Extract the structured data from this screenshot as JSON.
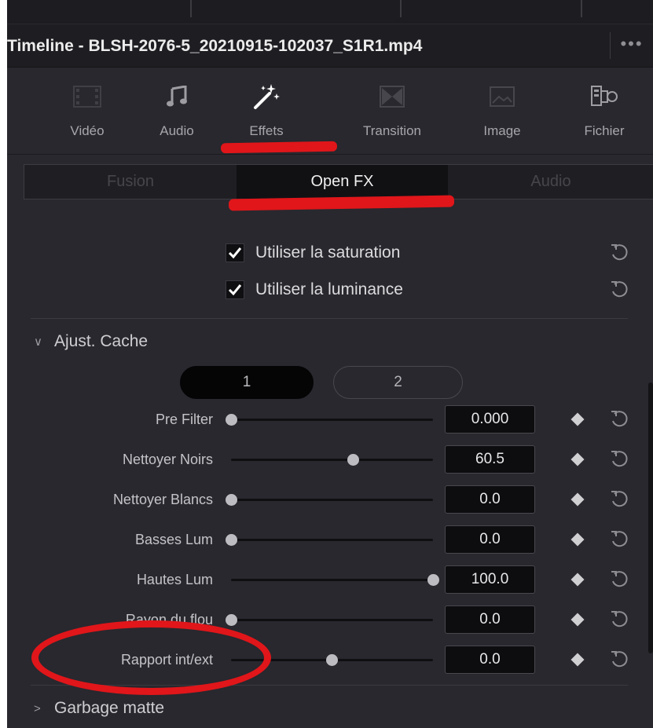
{
  "window": {
    "title": "Timeline - BLSH-2076-5_20210915-102037_S1R1.mp4",
    "more_label": "•••"
  },
  "inspector_tabs": [
    {
      "label": "Vidéo",
      "icon": "film-icon",
      "state": "normal"
    },
    {
      "label": "Audio",
      "icon": "music-note-icon",
      "state": "normal"
    },
    {
      "label": "Effets",
      "icon": "magic-wand-icon",
      "state": "active"
    },
    {
      "label": "Transition",
      "icon": "transition-icon",
      "state": "disabled"
    },
    {
      "label": "Image",
      "icon": "image-icon",
      "state": "disabled"
    },
    {
      "label": "Fichier",
      "icon": "camera-file-icon",
      "state": "normal"
    }
  ],
  "sub_tabs": [
    {
      "label": "Fusion",
      "active": false
    },
    {
      "label": "Open FX",
      "active": true
    },
    {
      "label": "Audio",
      "active": false
    }
  ],
  "checkboxes": [
    {
      "label": "Utiliser la saturation",
      "checked": true
    },
    {
      "label": "Utiliser la luminance",
      "checked": true
    }
  ],
  "section": {
    "label": "Ajust. Cache",
    "expanded": true,
    "segments": [
      "1",
      "2"
    ],
    "selected_segment": "1"
  },
  "params": [
    {
      "label": "Pre Filter",
      "value": "0.000",
      "slider_fraction": 0.0
    },
    {
      "label": "Nettoyer Noirs",
      "value": "60.5",
      "slider_fraction": 0.605
    },
    {
      "label": "Nettoyer Blancs",
      "value": "0.0",
      "slider_fraction": 0.0
    },
    {
      "label": "Basses Lum",
      "value": "0.0",
      "slider_fraction": 0.0
    },
    {
      "label": "Hautes Lum",
      "value": "100.0",
      "slider_fraction": 1.0
    },
    {
      "label": "Rayon du flou",
      "value": "0.0",
      "slider_fraction": 0.0
    },
    {
      "label": "Rapport int/ext",
      "value": "0.0",
      "slider_fraction": 0.5
    }
  ],
  "collapsed_section": {
    "label": "Garbage matte",
    "expanded": false
  },
  "colors": {
    "panel_bg": "#28282e",
    "annotation_red": "#e0161a",
    "active_text": "#ffffff",
    "disabled_text": "#4f4f55"
  }
}
